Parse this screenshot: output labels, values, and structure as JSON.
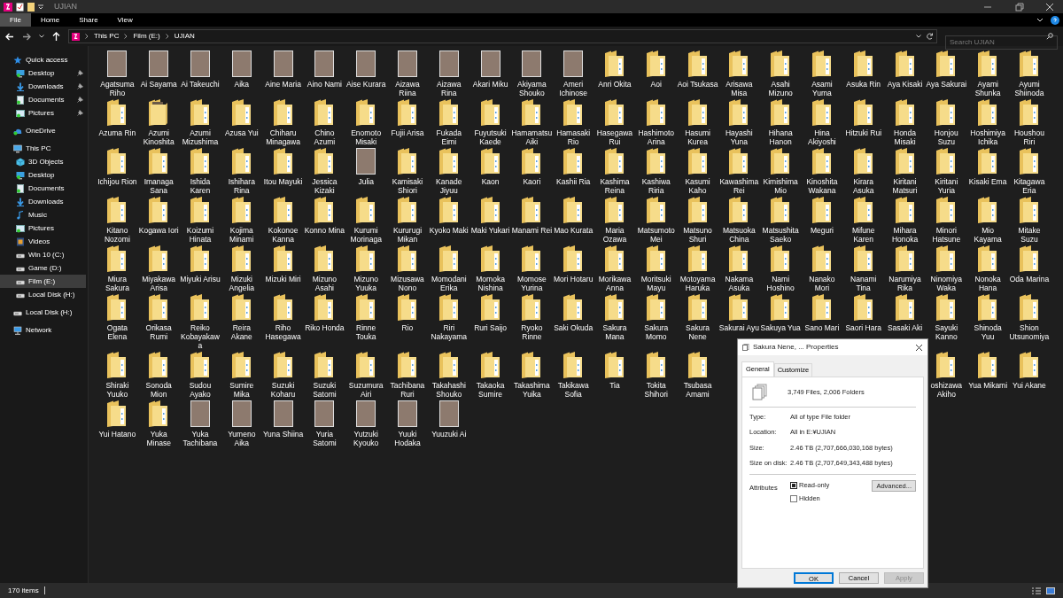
{
  "window": {
    "title": "UJIAN"
  },
  "ribbon_tabs": [
    {
      "label": "File",
      "selected": true
    },
    {
      "label": "Home",
      "selected": false
    },
    {
      "label": "Share",
      "selected": false
    },
    {
      "label": "View",
      "selected": false
    }
  ],
  "breadcrumb": [
    "This PC",
    "Film (E:)",
    "UJIAN"
  ],
  "search": {
    "placeholder": "Search UJIAN"
  },
  "sidebar": [
    {
      "label": "Quick access",
      "kind": "star",
      "selected": false,
      "children": [
        {
          "label": "Desktop",
          "kind": "desktop",
          "pinned": true,
          "selected": false
        },
        {
          "label": "Downloads",
          "kind": "download",
          "pinned": true,
          "selected": false
        },
        {
          "label": "Documents",
          "kind": "document",
          "pinned": true,
          "selected": false
        },
        {
          "label": "Pictures",
          "kind": "picture",
          "pinned": true,
          "selected": false
        }
      ]
    },
    {
      "label": "OneDrive",
      "kind": "cloud",
      "selected": false
    },
    {
      "label": "This PC",
      "kind": "pc",
      "selected": false,
      "children": [
        {
          "label": "3D Objects",
          "kind": "cube",
          "selected": false
        },
        {
          "label": "Desktop",
          "kind": "desktop",
          "selected": false
        },
        {
          "label": "Documents",
          "kind": "document",
          "selected": false
        },
        {
          "label": "Downloads",
          "kind": "download",
          "selected": false
        },
        {
          "label": "Music",
          "kind": "music",
          "selected": false
        },
        {
          "label": "Pictures",
          "kind": "picture",
          "selected": false
        },
        {
          "label": "Videos",
          "kind": "video",
          "selected": false
        },
        {
          "label": "Win 10 (C:)",
          "kind": "drive",
          "selected": false
        },
        {
          "label": "Game (D:)",
          "kind": "drive",
          "selected": false
        },
        {
          "label": "Film (E:)",
          "kind": "drive",
          "selected": true
        },
        {
          "label": "Local Disk (H:)",
          "kind": "drive",
          "selected": false
        }
      ]
    },
    {
      "label": "Local Disk (H:)",
      "kind": "drive",
      "selected": false
    },
    {
      "label": "Network",
      "kind": "network",
      "selected": false
    }
  ],
  "items": [
    {
      "label": "Agatsuma Riho",
      "kind": "photo"
    },
    {
      "label": "Ai Sayama",
      "kind": "photo"
    },
    {
      "label": "Ai Takeuchi",
      "kind": "photo"
    },
    {
      "label": "Aika",
      "kind": "photo"
    },
    {
      "label": "Aine Maria",
      "kind": "photo"
    },
    {
      "label": "Aino Nami",
      "kind": "photo"
    },
    {
      "label": "Aise Kurara",
      "kind": "photo"
    },
    {
      "label": "Aizawa Riina",
      "kind": "photo"
    },
    {
      "label": "Aizawa Rina",
      "kind": "photo"
    },
    {
      "label": "Akari Miku",
      "kind": "photo"
    },
    {
      "label": "Akiyama Shouko",
      "kind": "photo"
    },
    {
      "label": "Ameri Ichinose",
      "kind": "photo"
    },
    {
      "label": "Anri Okita",
      "kind": "folder"
    },
    {
      "label": "Aoi",
      "kind": "folder"
    },
    {
      "label": "Aoi Tsukasa",
      "kind": "folder"
    },
    {
      "label": "Arisawa Misa",
      "kind": "folder"
    },
    {
      "label": "Asahi Mizuno",
      "kind": "folder"
    },
    {
      "label": "Asami Yuma",
      "kind": "folder"
    },
    {
      "label": "Asuka Rin",
      "kind": "folder"
    },
    {
      "label": "Aya Kisaki",
      "kind": "folder"
    },
    {
      "label": "Aya Sakurai",
      "kind": "folder"
    },
    {
      "label": "Ayami Shunka",
      "kind": "folder"
    },
    {
      "label": "Ayumi Shiinoda",
      "kind": "folder"
    },
    {
      "label": "Azuma Rin",
      "kind": "folder"
    },
    {
      "label": "Azumi Kinoshita",
      "kind": "photo_folder"
    },
    {
      "label": "Azumi Mizushima",
      "kind": "folder"
    },
    {
      "label": "Azusa Yui",
      "kind": "folder"
    },
    {
      "label": "Chiharu Minagawa",
      "kind": "folder"
    },
    {
      "label": "Chino Azumi",
      "kind": "folder"
    },
    {
      "label": "Enomoto Misaki",
      "kind": "folder"
    },
    {
      "label": "Fujii Arisa",
      "kind": "folder"
    },
    {
      "label": "Fukada Eimi",
      "kind": "folder"
    },
    {
      "label": "Fuyutsuki Kaede",
      "kind": "folder"
    },
    {
      "label": "Hamamatsu Aiki",
      "kind": "folder"
    },
    {
      "label": "Hamasaki Rio",
      "kind": "folder"
    },
    {
      "label": "Hasegawa Rui",
      "kind": "folder"
    },
    {
      "label": "Hashimoto Arina",
      "kind": "folder"
    },
    {
      "label": "Hasumi Kurea",
      "kind": "folder"
    },
    {
      "label": "Hayashi Yuna",
      "kind": "folder"
    },
    {
      "label": "Hihana Hanon",
      "kind": "folder"
    },
    {
      "label": "Hina Akiyoshi",
      "kind": "folder"
    },
    {
      "label": "Hitzuki Rui",
      "kind": "folder"
    },
    {
      "label": "Honda Misaki",
      "kind": "folder"
    },
    {
      "label": "Honjou Suzu",
      "kind": "folder"
    },
    {
      "label": "Hoshimiya Ichika",
      "kind": "folder"
    },
    {
      "label": "Houshou Riri",
      "kind": "folder"
    },
    {
      "label": "Ichijou Rion",
      "kind": "folder"
    },
    {
      "label": "Imanaga Sana",
      "kind": "folder"
    },
    {
      "label": "Ishida Karen",
      "kind": "folder"
    },
    {
      "label": "Ishihara Rina",
      "kind": "folder"
    },
    {
      "label": "Itou Mayuki",
      "kind": "folder"
    },
    {
      "label": "Jessica Kizaki",
      "kind": "folder"
    },
    {
      "label": "Julia",
      "kind": "photo"
    },
    {
      "label": "Kamisaki Shiori",
      "kind": "folder"
    },
    {
      "label": "Kanade Jiyuu",
      "kind": "folder"
    },
    {
      "label": "Kaon",
      "kind": "folder"
    },
    {
      "label": "Kaori",
      "kind": "folder"
    },
    {
      "label": "Kashii Ria",
      "kind": "folder"
    },
    {
      "label": "Kashima Reina",
      "kind": "folder"
    },
    {
      "label": "Kashiwa Riria",
      "kind": "folder"
    },
    {
      "label": "Kasumi Kaho",
      "kind": "folder"
    },
    {
      "label": "Kawashima Rei",
      "kind": "folder"
    },
    {
      "label": "Kimishima Mio",
      "kind": "folder"
    },
    {
      "label": "Kinoshita Wakana",
      "kind": "folder"
    },
    {
      "label": "Kirara Asuka",
      "kind": "folder"
    },
    {
      "label": "Kiritani Matsuri",
      "kind": "folder"
    },
    {
      "label": "Kiritani Yuria",
      "kind": "folder"
    },
    {
      "label": "Kisaki Ema",
      "kind": "folder"
    },
    {
      "label": "Kitagawa Eria",
      "kind": "folder"
    },
    {
      "label": "Kitano Nozomi",
      "kind": "folder"
    },
    {
      "label": "Kogawa Iori",
      "kind": "folder"
    },
    {
      "label": "Koizumi Hinata",
      "kind": "folder"
    },
    {
      "label": "Kojima Minami",
      "kind": "folder"
    },
    {
      "label": "Kokonoe Kanna",
      "kind": "folder"
    },
    {
      "label": "Konno Mina",
      "kind": "folder"
    },
    {
      "label": "Kurumi Morinaga",
      "kind": "folder"
    },
    {
      "label": "Kururugi Mikan",
      "kind": "folder"
    },
    {
      "label": "Kyoko Maki",
      "kind": "folder"
    },
    {
      "label": "Maki Yukari",
      "kind": "folder"
    },
    {
      "label": "Manami Rei",
      "kind": "folder"
    },
    {
      "label": "Mao Kurata",
      "kind": "folder"
    },
    {
      "label": "Maria Ozawa",
      "kind": "folder"
    },
    {
      "label": "Matsumoto Mei",
      "kind": "folder"
    },
    {
      "label": "Matsuno Shuri",
      "kind": "folder"
    },
    {
      "label": "Matsuoka China",
      "kind": "folder"
    },
    {
      "label": "Matsushita Saeko",
      "kind": "folder"
    },
    {
      "label": "Meguri",
      "kind": "folder"
    },
    {
      "label": "Mifune Karen",
      "kind": "folder"
    },
    {
      "label": "Mihara Honoka",
      "kind": "folder"
    },
    {
      "label": "Minori Hatsune",
      "kind": "folder"
    },
    {
      "label": "Mio Kayama",
      "kind": "folder"
    },
    {
      "label": "Mitake Suzu",
      "kind": "folder"
    },
    {
      "label": "Miura Sakura",
      "kind": "folder"
    },
    {
      "label": "Miyakawa Arisa",
      "kind": "folder"
    },
    {
      "label": "Miyuki Arisu",
      "kind": "folder"
    },
    {
      "label": "Mizuki Angelia",
      "kind": "folder"
    },
    {
      "label": "Mizuki Miri",
      "kind": "folder"
    },
    {
      "label": "Mizuno Asahi",
      "kind": "folder"
    },
    {
      "label": "Mizuno Yuuka",
      "kind": "folder"
    },
    {
      "label": "Mizusawa Nono",
      "kind": "folder"
    },
    {
      "label": "Momodani Erika",
      "kind": "folder"
    },
    {
      "label": "Momoka Nishina",
      "kind": "folder"
    },
    {
      "label": "Momose Yurina",
      "kind": "folder"
    },
    {
      "label": "Mori Hotaru",
      "kind": "folder"
    },
    {
      "label": "Morikawa Anna",
      "kind": "folder"
    },
    {
      "label": "Moritsuki Mayu",
      "kind": "folder"
    },
    {
      "label": "Motoyama Haruka",
      "kind": "folder"
    },
    {
      "label": "Nakama Asuka",
      "kind": "folder"
    },
    {
      "label": "Nami Hoshino",
      "kind": "folder"
    },
    {
      "label": "Nanako Mori",
      "kind": "folder"
    },
    {
      "label": "Nanami Tina",
      "kind": "folder"
    },
    {
      "label": "Narumiya Rika",
      "kind": "folder"
    },
    {
      "label": "Ninomiya Waka",
      "kind": "folder"
    },
    {
      "label": "Nonoka Hana",
      "kind": "folder"
    },
    {
      "label": "Oda Marina",
      "kind": "folder"
    },
    {
      "label": "Ogata Elena",
      "kind": "folder"
    },
    {
      "label": "Orikasa Rumi",
      "kind": "folder"
    },
    {
      "label": "Reiko Kobayakawa",
      "kind": "folder"
    },
    {
      "label": "Reira Akane",
      "kind": "folder"
    },
    {
      "label": "Riho Hasegawa",
      "kind": "folder"
    },
    {
      "label": "Riko Honda",
      "kind": "folder"
    },
    {
      "label": "Rinne Touka",
      "kind": "folder"
    },
    {
      "label": "Rio",
      "kind": "folder"
    },
    {
      "label": "Riri Nakayama",
      "kind": "folder"
    },
    {
      "label": "Ruri Saijo",
      "kind": "folder"
    },
    {
      "label": "Ryoko Rinne",
      "kind": "folder"
    },
    {
      "label": "Saki Okuda",
      "kind": "folder"
    },
    {
      "label": "Sakura Mana",
      "kind": "folder"
    },
    {
      "label": "Sakura Momo",
      "kind": "folder"
    },
    {
      "label": "Sakura Nene",
      "kind": "folder"
    },
    {
      "label": "Sakurai Ayu",
      "kind": "folder"
    },
    {
      "label": "Sakuya Yua",
      "kind": "folder"
    },
    {
      "label": "Sano Mari",
      "kind": "folder"
    },
    {
      "label": "Saori Hara",
      "kind": "folder"
    },
    {
      "label": "Sasaki Aki",
      "kind": "folder"
    },
    {
      "label": "Sayuki Kanno",
      "kind": "folder"
    },
    {
      "label": "Shinoda Yuu",
      "kind": "folder"
    },
    {
      "label": "Shion Utsunomiya",
      "kind": "folder"
    },
    {
      "label": "Shiraki Yuuko",
      "kind": "folder"
    },
    {
      "label": "Sonoda Mion",
      "kind": "folder"
    },
    {
      "label": "Sudou Ayako",
      "kind": "folder"
    },
    {
      "label": "Sumire Mika",
      "kind": "folder"
    },
    {
      "label": "Suzuki Koharu",
      "kind": "folder"
    },
    {
      "label": "Suzuki Satomi",
      "kind": "folder"
    },
    {
      "label": "Suzumura Airi",
      "kind": "folder"
    },
    {
      "label": "Tachibana Ruri",
      "kind": "folder"
    },
    {
      "label": "Takahashi Shouko",
      "kind": "folder"
    },
    {
      "label": "Takaoka Sumire",
      "kind": "folder"
    },
    {
      "label": "Takashima Yuika",
      "kind": "folder"
    },
    {
      "label": "Takikawa Sofia",
      "kind": "folder"
    },
    {
      "label": "Tia",
      "kind": "folder"
    },
    {
      "label": "Tokita Shihori",
      "kind": "folder"
    },
    {
      "label": "Tsubasa Amami",
      "kind": "folder"
    },
    {
      "kind": "covered"
    },
    {
      "kind": "covered"
    },
    {
      "kind": "covered"
    },
    {
      "kind": "covered"
    },
    {
      "kind": "covered"
    },
    {
      "label": "oshizawa Akiho",
      "kind": "folder"
    },
    {
      "label": "Yua Mikami",
      "kind": "folder"
    },
    {
      "label": "Yui Akane",
      "kind": "folder"
    },
    {
      "label": "Yui Hatano",
      "kind": "folder"
    },
    {
      "label": "Yuka Minase",
      "kind": "folder"
    },
    {
      "label": "Yuka Tachibana",
      "kind": "photo"
    },
    {
      "label": "Yumeno Aika",
      "kind": "photo"
    },
    {
      "label": "Yuna Shiina",
      "kind": "photo"
    },
    {
      "label": "Yuria Satomi",
      "kind": "photo"
    },
    {
      "label": "Yutzuki Kyouko",
      "kind": "photo"
    },
    {
      "label": "Yuuki Hodaka",
      "kind": "photo"
    },
    {
      "label": "Yuuzuki Ai",
      "kind": "photo"
    }
  ],
  "status_bar": {
    "count": "170 items"
  },
  "dialog": {
    "title": "Sakura Nene, ... Properties",
    "tabs": [
      {
        "label": "General",
        "selected": true
      },
      {
        "label": "Customize",
        "selected": false
      }
    ],
    "summary": "3,749 Files, 2,006 Folders",
    "fields": [
      {
        "label": "Type:",
        "value": "All of type File folder"
      },
      {
        "label": "Location:",
        "value": "All in E:¥UJIAN"
      },
      {
        "label": "Size:",
        "value": "2.46 TB (2,707,666,030,168 bytes)"
      },
      {
        "label": "Size on disk:",
        "value": "2.46 TB (2,707,649,343,488 bytes)"
      }
    ],
    "attributes_label": "Attributes",
    "attributes": [
      {
        "label": "Read-only",
        "checked": true,
        "indeterminate": true
      },
      {
        "label": "Hidden",
        "checked": false,
        "indeterminate": false
      }
    ],
    "advanced_button": "Advanced...",
    "buttons": [
      {
        "label": "OK",
        "kind": "default",
        "disabled": false
      },
      {
        "label": "Cancel",
        "kind": "normal",
        "disabled": false
      },
      {
        "label": "Apply",
        "kind": "normal",
        "disabled": true
      }
    ]
  }
}
